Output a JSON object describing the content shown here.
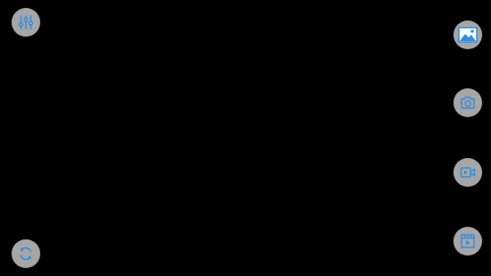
{
  "colors": {
    "background": "#000000",
    "button_fill": "#a6a6a6",
    "icon_accent": "#2f8ee0"
  },
  "controls": {
    "top_left": {
      "icon": "sliders-icon"
    },
    "bottom_left": {
      "icon": "switch-camera-icon"
    },
    "right_column": [
      {
        "icon": "gallery-icon"
      },
      {
        "icon": "camera-icon"
      },
      {
        "icon": "video-camera-icon"
      },
      {
        "icon": "video-clip-icon"
      }
    ]
  }
}
